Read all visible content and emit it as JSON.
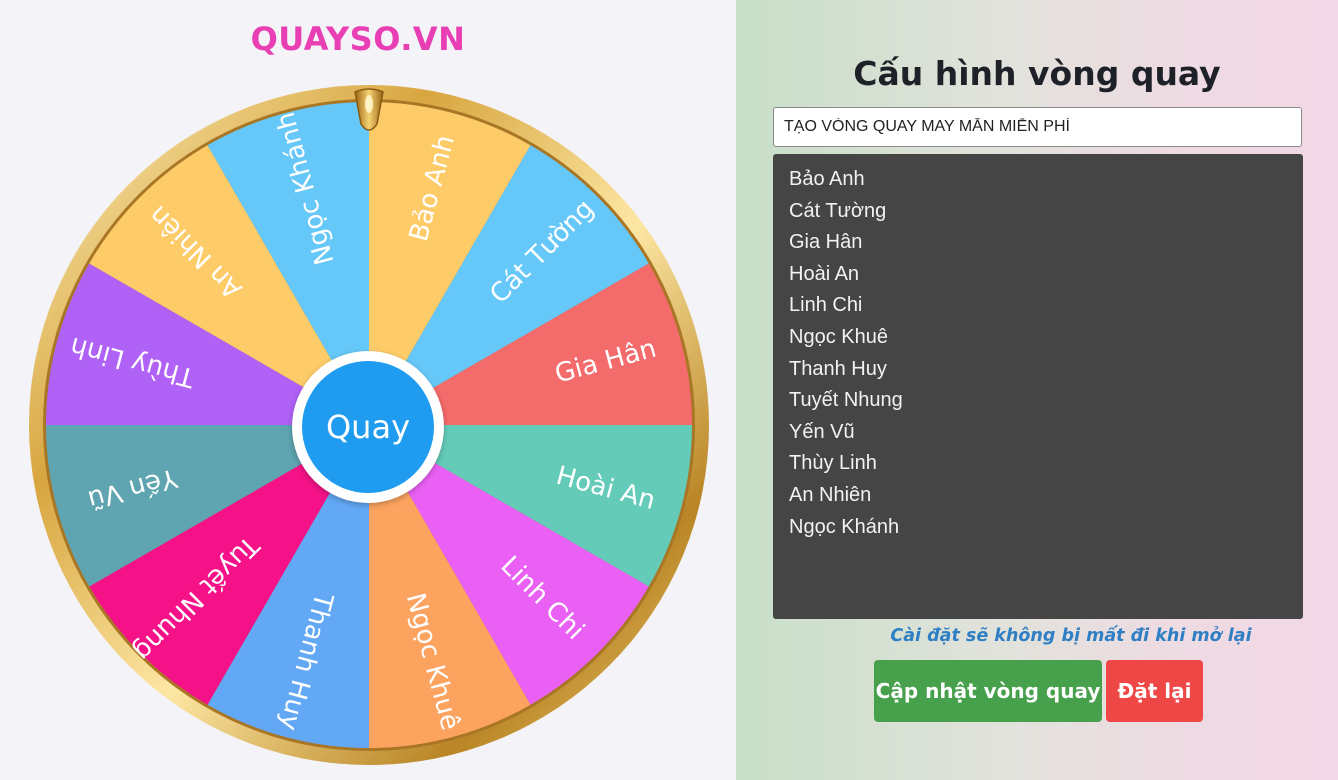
{
  "brand": "QUAYSO.VN",
  "wheel": {
    "spin_label": "Quay",
    "segments": [
      {
        "label": "Bảo Anh",
        "color": "#fecb69"
      },
      {
        "label": "Cát Tường",
        "color": "#66c8f9"
      },
      {
        "label": "Gia Hân",
        "color": "#f46b6b"
      },
      {
        "label": "Hoài An",
        "color": "#65cbb9"
      },
      {
        "label": "Linh Chi",
        "color": "#ea60f5"
      },
      {
        "label": "Ngọc Khuê",
        "color": "#fca360"
      },
      {
        "label": "Thanh Huy",
        "color": "#62a8f5"
      },
      {
        "label": "Tuyết Nhung",
        "color": "#f51288"
      },
      {
        "label": "Yến Vũ",
        "color": "#5fa4b1"
      },
      {
        "label": "Thùy Linh",
        "color": "#b061f6"
      },
      {
        "label": "An Nhiên",
        "color": "#fecb69"
      },
      {
        "label": "Ngọc Khánh",
        "color": "#66c8f9"
      }
    ]
  },
  "config": {
    "title": "Cấu hình vòng quay",
    "title_input_value": "TẠO VÒNG QUAY MAY MẮN MIỄN PHÍ",
    "names": [
      "Bảo Anh",
      "Cát Tường",
      "Gia Hân",
      "Hoài An",
      "Linh Chi",
      "Ngọc Khuê",
      "Thanh Huy",
      "Tuyết Nhung",
      "Yến Vũ",
      "Thùy Linh",
      "An Nhiên",
      "Ngọc Khánh"
    ],
    "note": "Cài đặt sẽ không bị mất đi khi mở lại",
    "update_button": "Cập nhật vòng quay",
    "reset_button": "Đặt lại"
  }
}
